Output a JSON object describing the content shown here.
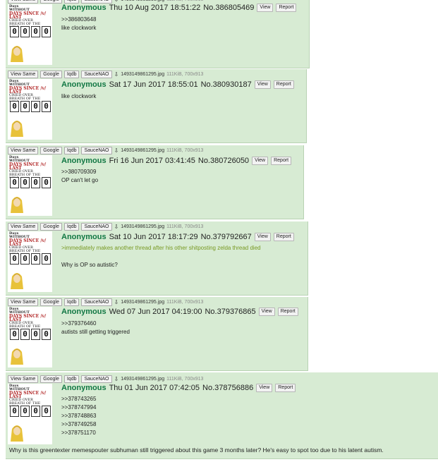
{
  "header_buttons": {
    "view_same": "View Same",
    "google": "Google",
    "iqdb": "Iqdb",
    "saucenao": "SauceNAO"
  },
  "file": {
    "name": "1493149861295.jpg",
    "size": "111KiB, 700x913"
  },
  "thumb": {
    "line1": "Days",
    "line2": "WITHOUT",
    "line3": "DAYS SINCE /v/ LAST",
    "line4": "CRIED OVER",
    "line5": "BREATH OF THE WILD",
    "digits": [
      "0",
      "0",
      "0",
      "0"
    ]
  },
  "post_buttons": {
    "view": "View",
    "report": "Report"
  },
  "posts": [
    {
      "name": "Anonymous",
      "datetime": "Thu 10 Aug 2017 18:51:22",
      "number": "No.386805469",
      "quote": ">>386803648",
      "text": "like clockwork"
    },
    {
      "name": "Anonymous",
      "datetime": "Sat 17 Jun 2017 18:55:01",
      "number": "No.380930187",
      "text": "like clockwork"
    },
    {
      "name": "Anonymous",
      "datetime": "Fri 16 Jun 2017 03:41:45",
      "number": "No.380726050",
      "quote": ">>380709309",
      "text": "OP can't let go"
    },
    {
      "name": "Anonymous",
      "datetime": "Sat 10 Jun 2017 18:17:29",
      "number": "No.379792667",
      "greentext": ">immediately makes another thread after his other shitposting zelda thread died",
      "text": "Why is OP so autistic?"
    },
    {
      "name": "Anonymous",
      "datetime": "Wed 07 Jun 2017 04:19:00",
      "number": "No.379376865",
      "quote": ">>379376460",
      "text": "autists still getting triggered"
    },
    {
      "name": "Anonymous",
      "datetime": "Thu 01 Jun 2017 07:42:05",
      "number": "No.378756886",
      "quotes": [
        ">>378743265",
        ">>378747994",
        ">>378748863",
        ">>378749258",
        ">>378751170"
      ],
      "text": "Why is this greentexter memespouter subhuman still triggered about this game 3 months later? He's easy to spot too due to his latent autism."
    }
  ]
}
